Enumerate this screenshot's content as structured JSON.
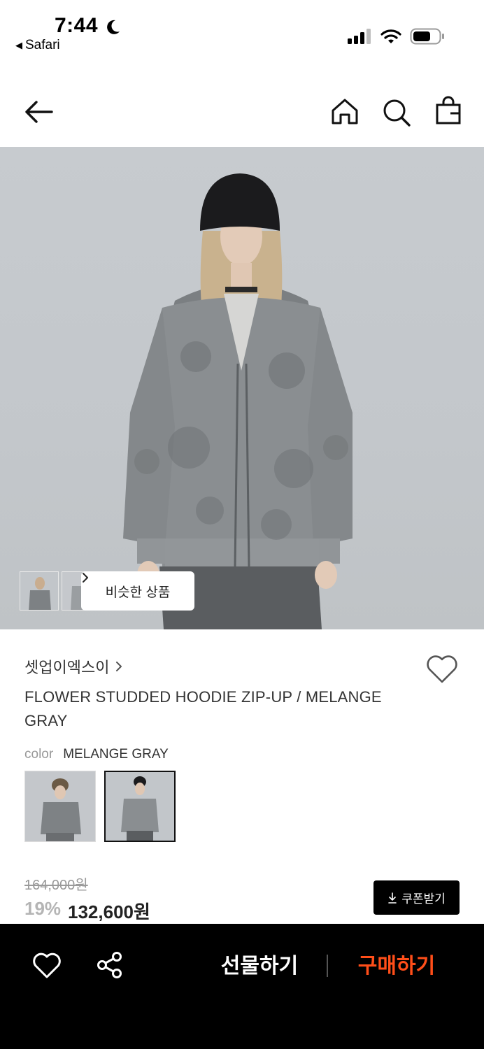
{
  "status_bar": {
    "time": "7:44",
    "back_app": "Safari",
    "icons": [
      "moon-icon",
      "signal-icon",
      "wifi-icon",
      "battery-icon"
    ]
  },
  "nav": {
    "icons": [
      "back-arrow-icon",
      "home-icon",
      "search-icon",
      "shopping-bag-icon"
    ]
  },
  "hero": {
    "similar_label": "비슷한 상품",
    "thumbnails": [
      "thumb-1",
      "thumb-2"
    ]
  },
  "product": {
    "brand": "셋업이엑스이",
    "title": "FLOWER STUDDED HOODIE ZIP-UP / MELANGE GRAY",
    "color_label": "color",
    "color_value": "MELANGE GRAY",
    "original_price": "164,000원",
    "discount": "19%",
    "sale_price": "132,600원",
    "coupon_label": "쿠폰받기"
  },
  "bottom_bar": {
    "gift_label": "선물하기",
    "buy_label": "구매하기",
    "buy_color": "#ff4e19"
  }
}
